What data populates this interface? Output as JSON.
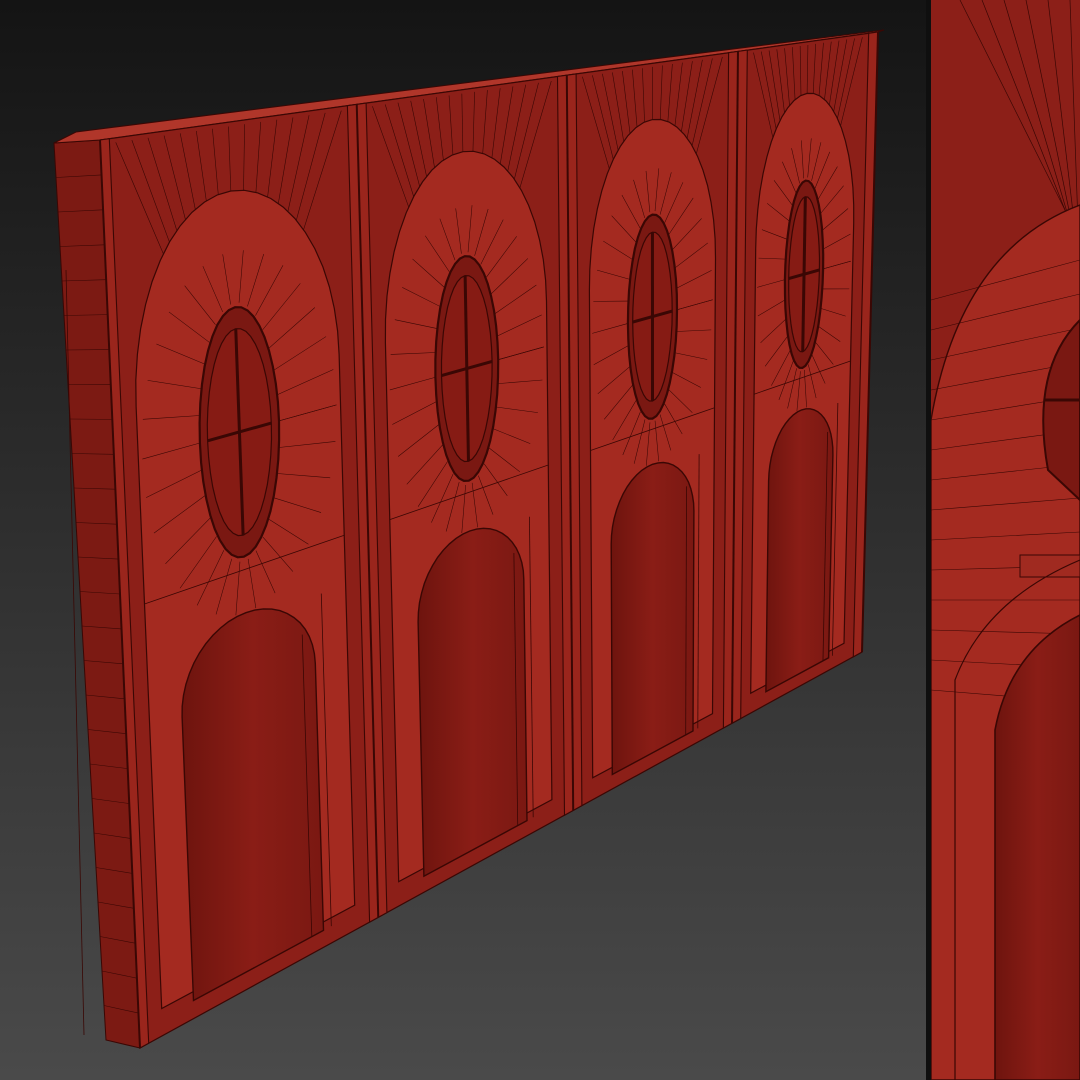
{
  "scene": {
    "kind": "3d-viewport-render",
    "subject": "arched-wall-module-wireframe",
    "panels": [
      "main-perspective-view",
      "closeup-detail-view"
    ],
    "bays": 4,
    "colors": {
      "viewport_top": "#141414",
      "viewport_bottom": "#4a4a4a",
      "model_face": "#8c1f18",
      "model_light": "#a42a20",
      "model_recess": "#7a1812",
      "model_edge_top": "#b0362a",
      "wireframe": "#3a0704",
      "separator": "#0f0f0f"
    }
  }
}
